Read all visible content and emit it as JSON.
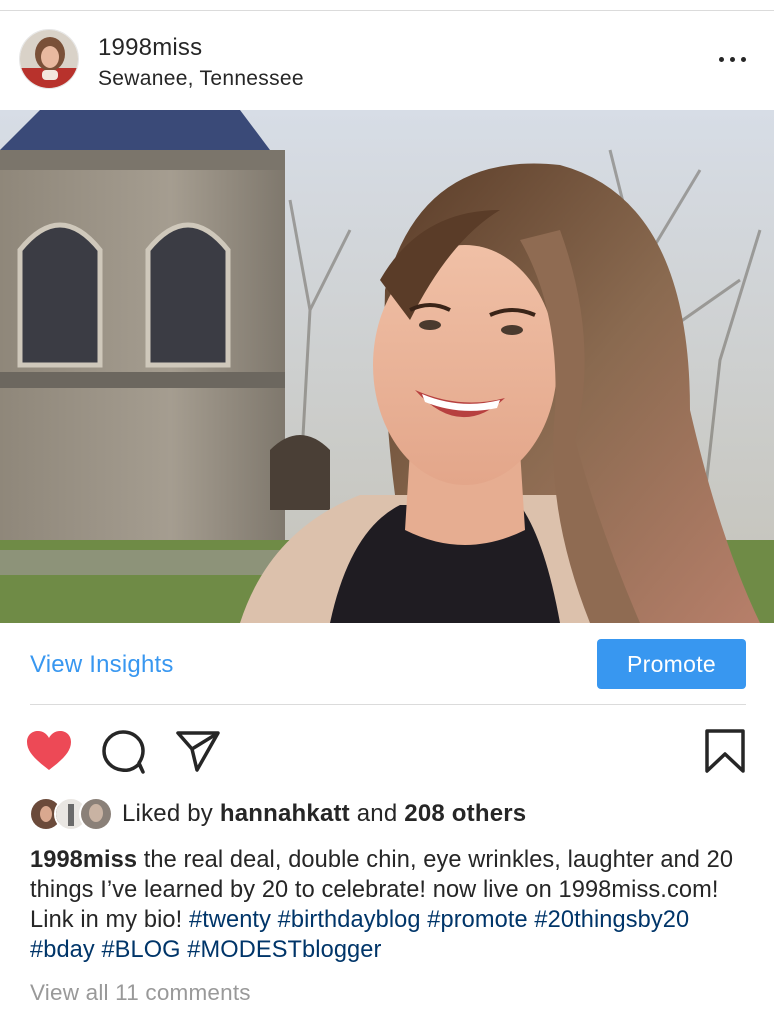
{
  "header": {
    "username": "1998miss",
    "location": "Sewanee, Tennessee",
    "more_icon": "more-horizontal-icon"
  },
  "photo": {
    "subject": "post-photo"
  },
  "insights": {
    "view_insights_label": "View Insights",
    "promote_label": "Promote",
    "accent_color": "#3897f0"
  },
  "actions": {
    "like_icon": "heart-filled-icon",
    "comment_icon": "comment-bubble-icon",
    "share_icon": "paper-plane-icon",
    "save_icon": "bookmark-icon",
    "like_color": "#ed4956"
  },
  "likes": {
    "prefix": "Liked by ",
    "first_liker": "hannahkatt",
    "joiner": " and ",
    "others": "208 others"
  },
  "caption": {
    "username": "1998miss",
    "text": " the real deal, double chin, eye wrinkles, laughter and 20 things I’ve learned by 20 to celebrate! now live on 1998miss.com! Link in my bio! ",
    "hashtags": [
      "#twenty",
      "#birthdayblog",
      "#promote",
      "#20thingsby20",
      "#bday",
      "#BLOG",
      "#MODESTblogger"
    ],
    "hashtag_color": "#003569"
  },
  "comments": {
    "view_all_label": "View all 11 comments"
  }
}
